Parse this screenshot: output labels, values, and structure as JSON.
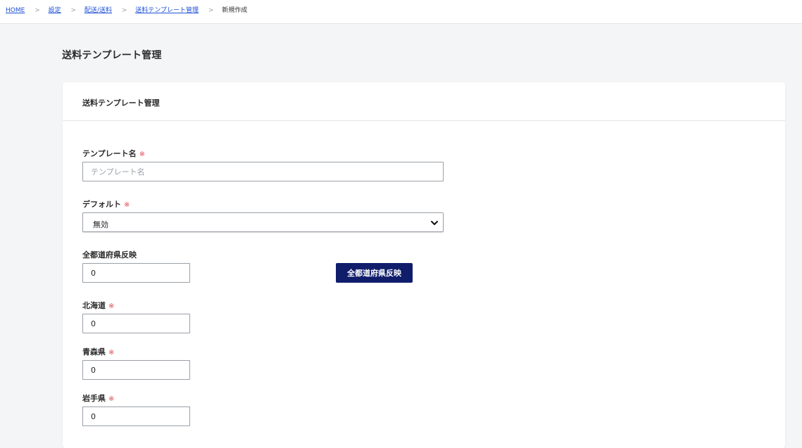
{
  "breadcrumb": {
    "items": [
      "HOME",
      "設定",
      "配送/送料",
      "送料テンプレート管理"
    ],
    "separator": ">",
    "current": "新規作成"
  },
  "page_title": "送料テンプレート管理",
  "card": {
    "title": "送料テンプレート管理"
  },
  "required_mark": "※",
  "form": {
    "template_name": {
      "label": "テンプレート名",
      "placeholder": "テンプレート名",
      "value": ""
    },
    "default": {
      "label": "デフォルト",
      "selected": "無効"
    },
    "all_prefectures": {
      "label": "全都道府県反映",
      "value": "0",
      "button_label": "全都道府県反映"
    },
    "prefectures": [
      {
        "label": "北海道",
        "value": "0"
      },
      {
        "label": "青森県",
        "value": "0"
      },
      {
        "label": "岩手県",
        "value": "0"
      }
    ]
  },
  "colors": {
    "accent_button": "#0f1d6b",
    "link": "#1d4fd8",
    "required": "#e0454d"
  }
}
